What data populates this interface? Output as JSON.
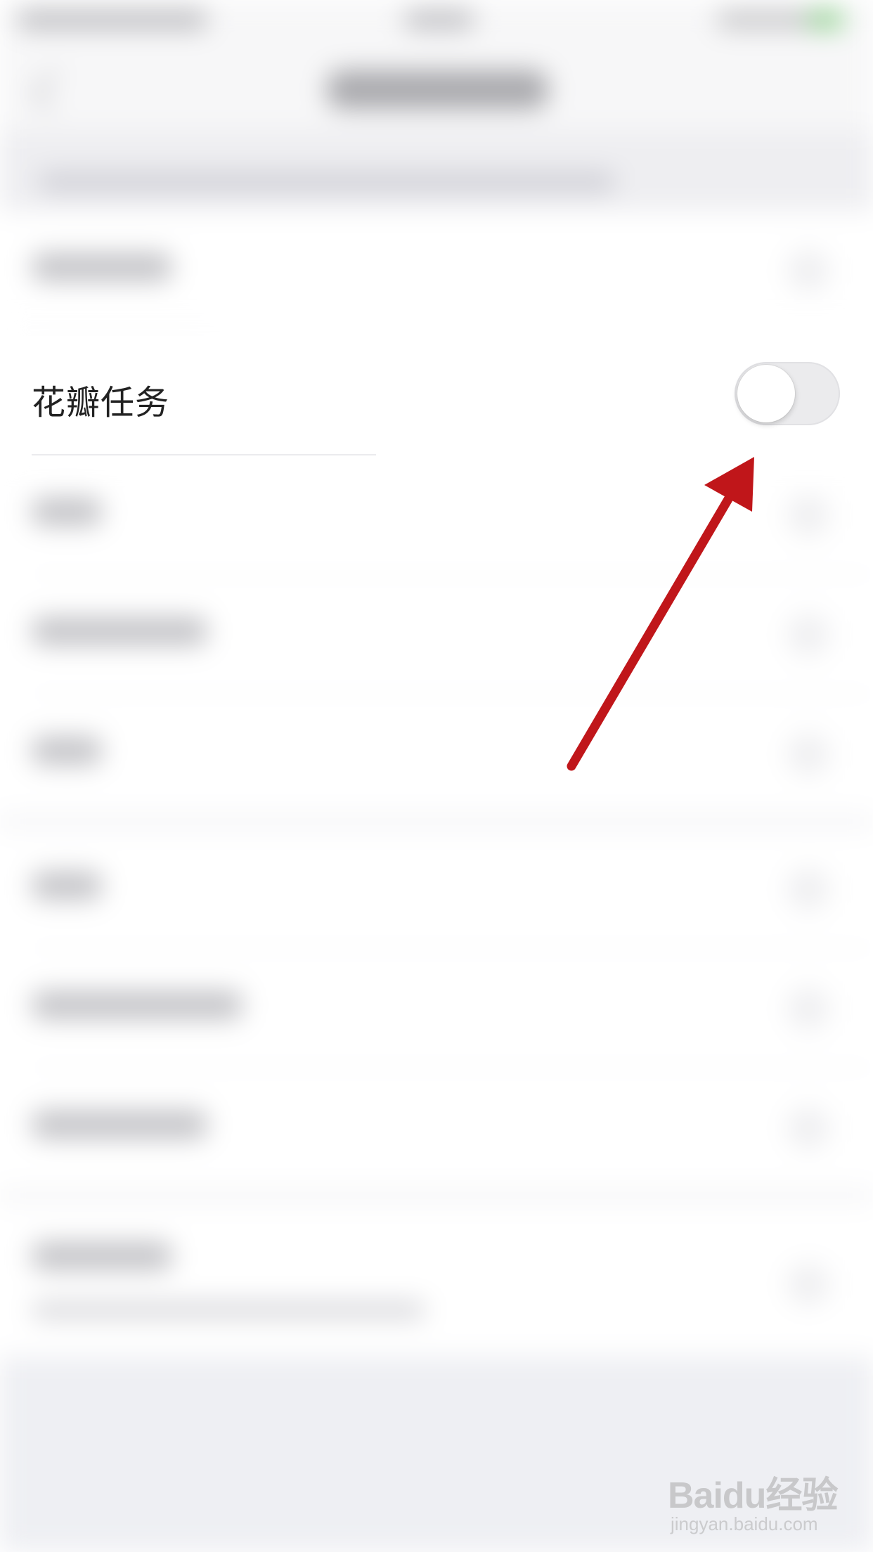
{
  "settings_row": {
    "label": "花瓣任务",
    "toggle_state": "off"
  },
  "annotation": {
    "arrow_color": "#c0161a"
  },
  "watermark": {
    "brand": "Baidu经验",
    "url": "jingyan.baidu.com"
  },
  "colors": {
    "toggle_track": "#ebebed",
    "toggle_knob": "#ffffff",
    "background": "#ffffff"
  }
}
